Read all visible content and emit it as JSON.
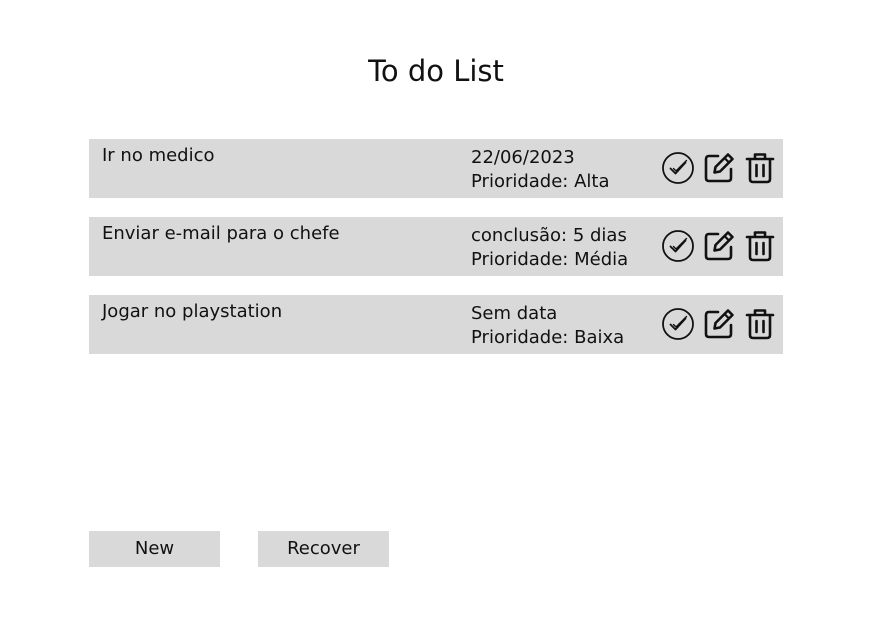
{
  "title": "To do List",
  "tasks": [
    {
      "name": "Ir no medico",
      "date": "22/06/2023",
      "priority": "Prioridade: Alta"
    },
    {
      "name": "Enviar e-mail para o chefe",
      "date": "conclusão: 5 dias",
      "priority": "Prioridade: Média"
    },
    {
      "name": "Jogar no playstation",
      "date": "Sem data",
      "priority": "Prioridade: Baixa"
    }
  ],
  "buttons": {
    "new_label": "New",
    "recover_label": "Recover"
  },
  "icons": {
    "complete": "check-circle-icon",
    "edit": "edit-icon",
    "delete": "trash-icon"
  },
  "colors": {
    "row_background": "#d9d9d9",
    "button_background": "#d9d9d9",
    "text": "#111111"
  }
}
